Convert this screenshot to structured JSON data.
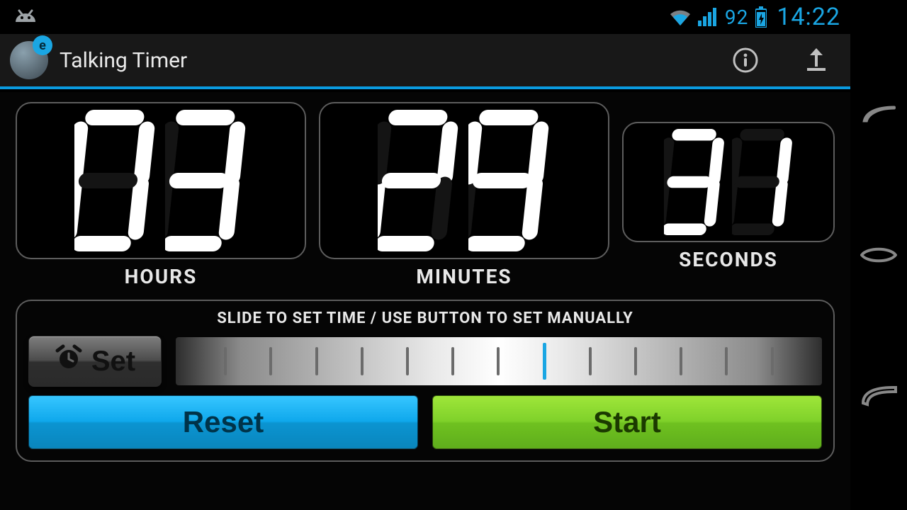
{
  "status": {
    "battery": "92",
    "clock": "14:22"
  },
  "app": {
    "title": "Talking Timer"
  },
  "timer": {
    "hours": "03",
    "minutes": "29",
    "seconds": "31",
    "labels": {
      "hours": "HOURS",
      "minutes": "MINUTES",
      "seconds": "SECONDS"
    }
  },
  "panel": {
    "hint": "SLIDE TO SET TIME / USE BUTTON TO SET MANUALLY",
    "set_label": "Set",
    "reset_label": "Reset",
    "start_label": "Start"
  }
}
